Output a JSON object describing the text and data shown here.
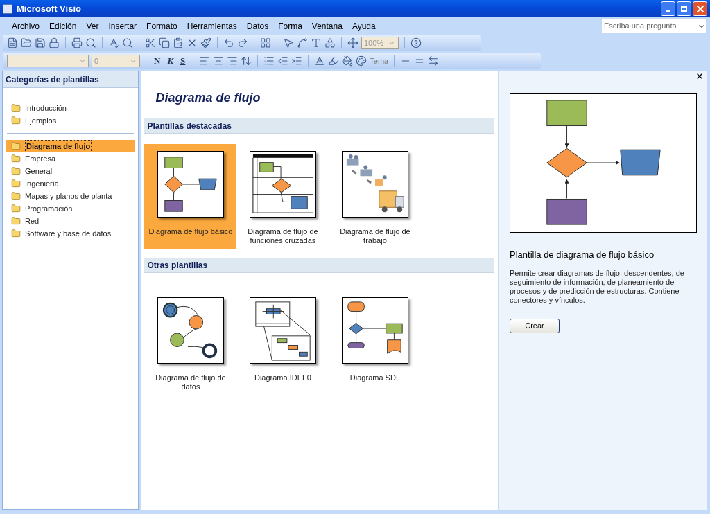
{
  "window": {
    "title": "Microsoft Visio"
  },
  "menu": [
    "Archivo",
    "Edición",
    "Ver",
    "Insertar",
    "Formato",
    "Herramientas",
    "Datos",
    "Forma",
    "Ventana",
    "Ayuda"
  ],
  "help_search": {
    "placeholder": "Escriba una pregunta"
  },
  "toolbar": {
    "zoom": "100%"
  },
  "format_toolbar": {
    "font_size": "0",
    "bold": "N",
    "italic": "K",
    "underline": "S",
    "theme": "Tema"
  },
  "sidebar": {
    "title": "Categorías de plantillas",
    "top_items": [
      {
        "label": "Introducción",
        "selected": false
      },
      {
        "label": "Ejemplos",
        "selected": false
      }
    ],
    "items": [
      {
        "label": "Diagrama de flujo",
        "selected": true
      },
      {
        "label": "Empresa",
        "selected": false
      },
      {
        "label": "General",
        "selected": false
      },
      {
        "label": "Ingeniería",
        "selected": false
      },
      {
        "label": "Mapas y planos de planta",
        "selected": false
      },
      {
        "label": "Programación",
        "selected": false
      },
      {
        "label": "Red",
        "selected": false
      },
      {
        "label": "Software y base de datos",
        "selected": false
      }
    ]
  },
  "content": {
    "title": "Diagrama de flujo",
    "sections": [
      {
        "title": "Plantillas destacadas",
        "templates": [
          {
            "kind": "basic",
            "label": "Diagrama de flujo básico",
            "selected": true
          },
          {
            "kind": "cross",
            "label": "Diagrama de flujo de funciones cruzadas",
            "selected": false
          },
          {
            "kind": "work",
            "label": "Diagrama de flujo de trabajo",
            "selected": false
          }
        ]
      },
      {
        "title": "Otras plantillas",
        "templates": [
          {
            "kind": "data",
            "label": "Diagrama de flujo de datos",
            "selected": false
          },
          {
            "kind": "idef0",
            "label": "Diagrama IDEF0",
            "selected": false
          },
          {
            "kind": "sdl",
            "label": "Diagrama SDL",
            "selected": false
          }
        ]
      }
    ]
  },
  "preview": {
    "title": "Plantilla de diagrama de flujo básico",
    "description": "Permite crear diagramas de flujo, descendentes, de seguimiento de información, de planeamiento de procesos y de predicción de estructuras. Contiene conectores y vínculos.",
    "button": "Crear"
  }
}
